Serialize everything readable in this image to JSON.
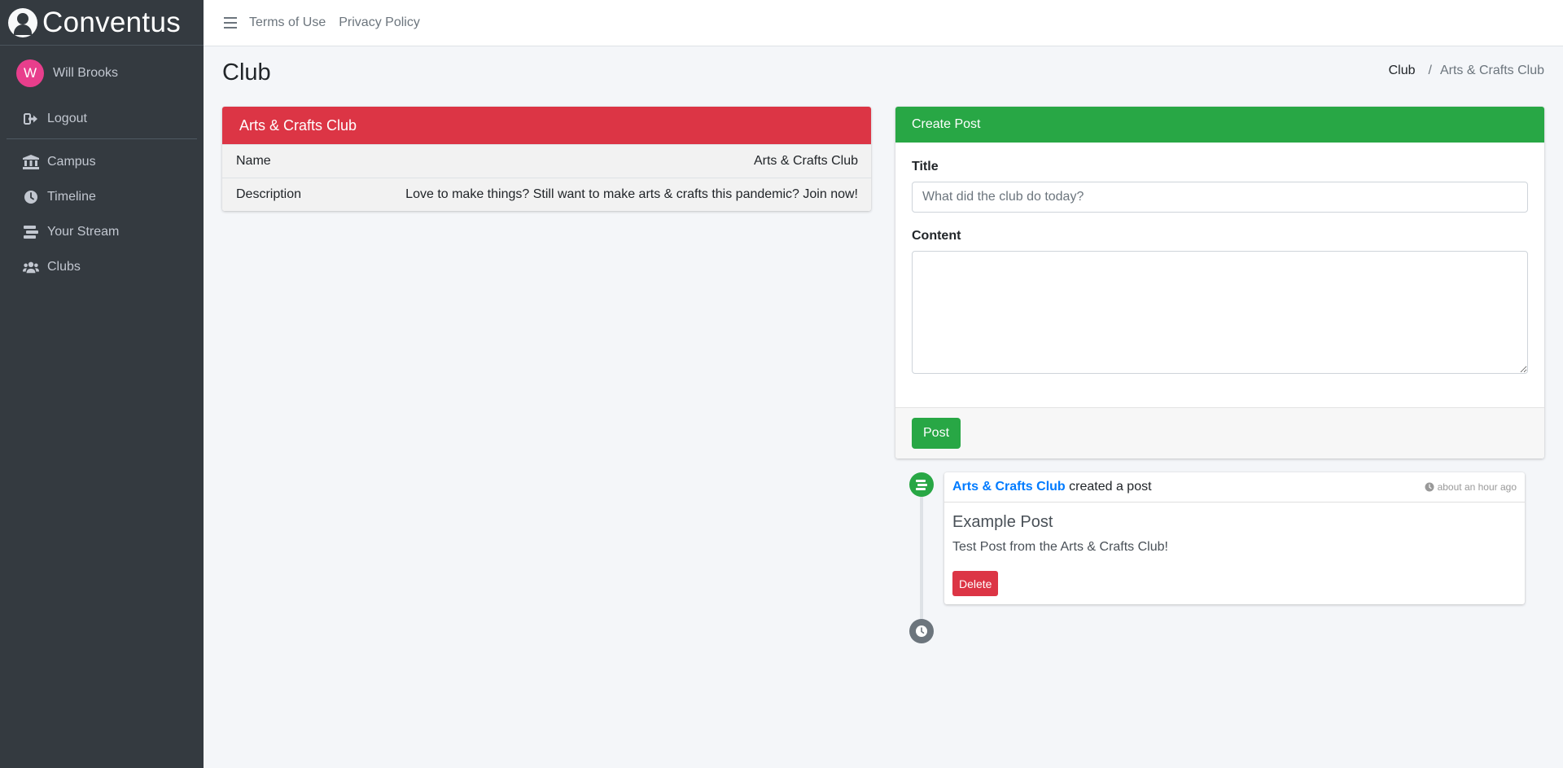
{
  "brand": {
    "name": "Conventus",
    "logo_icon": "user-circle-icon"
  },
  "user": {
    "name": "Will Brooks",
    "initial": "W",
    "avatar_color": "#e83e8c"
  },
  "sidebar": {
    "logout": {
      "label": "Logout",
      "icon": "sign-out-icon"
    },
    "items": [
      {
        "label": "Campus",
        "icon": "university-icon"
      },
      {
        "label": "Timeline",
        "icon": "clock-icon"
      },
      {
        "label": "Your Stream",
        "icon": "stream-icon"
      },
      {
        "label": "Clubs",
        "icon": "users-icon"
      }
    ]
  },
  "topbar": {
    "links": [
      "Terms of Use",
      "Privacy Policy"
    ]
  },
  "page": {
    "title": "Club"
  },
  "breadcrumb": {
    "parent": "Club",
    "separator": "/",
    "current": "Arts & Crafts Club"
  },
  "club": {
    "header": "Arts & Crafts Club",
    "rows": [
      {
        "label": "Name",
        "value": "Arts & Crafts Club"
      },
      {
        "label": "Description",
        "value": "Love to make things? Still want to make arts & crafts this pandemic? Join now!"
      }
    ]
  },
  "create_post": {
    "header": "Create Post",
    "title_label": "Title",
    "title_placeholder": "What did the club do today?",
    "title_value": "",
    "content_label": "Content",
    "content_value": "",
    "submit_label": "Post"
  },
  "timeline": {
    "items": [
      {
        "actor": "Arts & Crafts Club",
        "verb": "created a post",
        "time": "about an hour ago",
        "title": "Example Post",
        "body": "Test Post from the Arts & Crafts Club!",
        "delete_label": "Delete"
      }
    ]
  },
  "colors": {
    "sidebar_bg": "#343a40",
    "danger": "#dc3545",
    "success": "#28a745",
    "link": "#007bff",
    "muted": "#6c757d"
  }
}
